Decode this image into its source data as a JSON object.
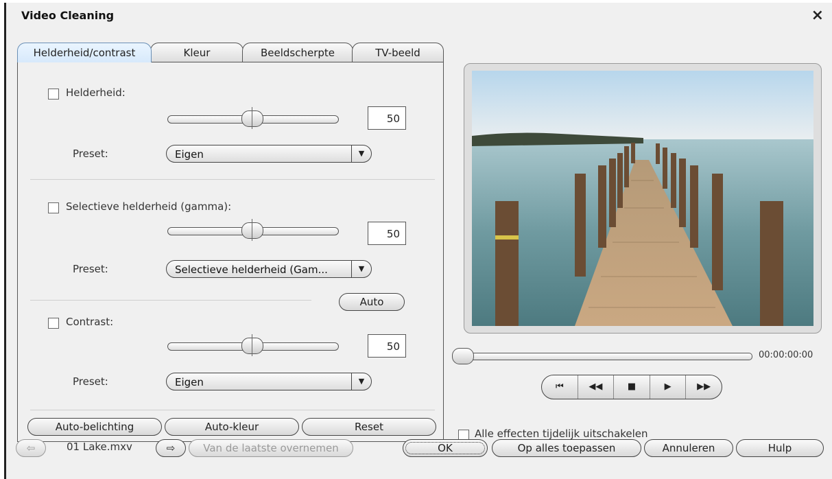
{
  "window": {
    "title": "Video Cleaning"
  },
  "tabs": [
    {
      "label": "Helderheid/contrast",
      "active": true
    },
    {
      "label": "Kleur"
    },
    {
      "label": "Beeldscherpte"
    },
    {
      "label": "TV-beeld"
    }
  ],
  "brightness": {
    "label": "Helderheid:",
    "value": "50",
    "slider_fraction": 0.5,
    "preset_label": "Preset:",
    "preset": "Eigen"
  },
  "gamma": {
    "label": "Selectieve helderheid (gamma):",
    "value": "50",
    "slider_fraction": 0.5,
    "preset_label": "Preset:",
    "preset": "Selectieve helderheid (Gam..."
  },
  "auto_button": "Auto",
  "contrast": {
    "label": "Contrast:",
    "value": "50",
    "slider_fraction": 0.5,
    "preset_label": "Preset:",
    "preset": "Eigen"
  },
  "panel_buttons": {
    "auto_exposure": "Auto-belichting",
    "auto_color": "Auto-kleur",
    "reset": "Reset"
  },
  "player": {
    "timecode": "00:00:00:00",
    "position_fraction": 0.0
  },
  "disable_all_label": "Alle effecten tijdelijk uitschakelen",
  "footer": {
    "filename": "01 Lake.mxv",
    "copy_last": "Van de laatste overnemen",
    "ok": "OK",
    "apply_all": "Op alles toepassen",
    "cancel": "Annuleren",
    "help": "Hulp"
  },
  "icons": {
    "prev_clip": "arrow-left-icon",
    "next_clip": "arrow-right-icon",
    "transport": [
      "skip-to-start-icon",
      "rewind-icon",
      "stop-icon",
      "play-icon",
      "fast-forward-icon"
    ]
  }
}
